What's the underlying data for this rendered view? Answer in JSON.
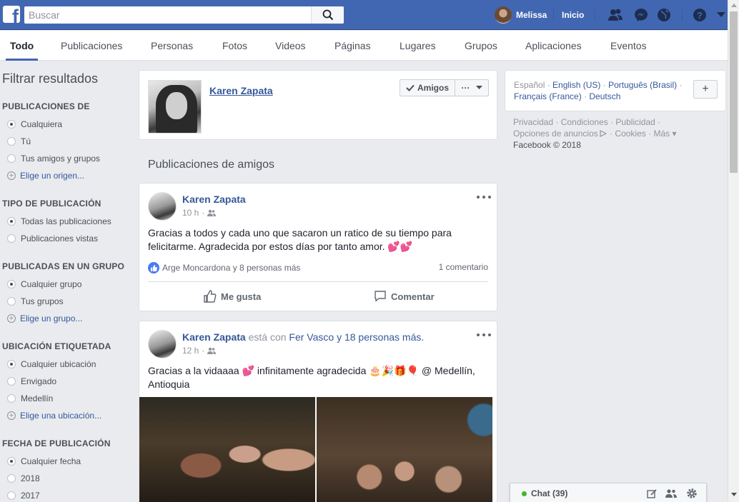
{
  "topbar": {
    "logo_letter": "f",
    "search_placeholder": "Buscar",
    "user_name": "Melissa",
    "home_label": "Inicio",
    "icons": [
      "facebook-logo-icon",
      "search-icon",
      "friend-requests-icon",
      "messenger-icon",
      "globe-notifications-icon",
      "help-icon",
      "caret-down-icon"
    ],
    "brand_color": "#4267b2"
  },
  "tabs": [
    {
      "label": "Todo",
      "active": true
    },
    {
      "label": "Publicaciones"
    },
    {
      "label": "Personas"
    },
    {
      "label": "Fotos"
    },
    {
      "label": "Videos"
    },
    {
      "label": "Páginas"
    },
    {
      "label": "Lugares"
    },
    {
      "label": "Grupos"
    },
    {
      "label": "Aplicaciones"
    },
    {
      "label": "Eventos"
    }
  ],
  "filter": {
    "title": "Filtrar resultados",
    "sections": [
      {
        "title": "PUBLICACIONES DE",
        "options": [
          "Cualquiera",
          "Tú",
          "Tus amigos y grupos"
        ],
        "add": "Elige un origen..."
      },
      {
        "title": "TIPO DE PUBLICACIÓN",
        "options": [
          "Todas las publicaciones",
          "Publicaciones vistas"
        ]
      },
      {
        "title": "PUBLICADAS EN UN GRUPO",
        "options": [
          "Cualquier grupo",
          "Tus grupos"
        ],
        "add": "Elige un grupo..."
      },
      {
        "title": "UBICACIÓN ETIQUETADA",
        "options": [
          "Cualquier ubicación",
          "Envigado",
          "Medellín"
        ],
        "add": "Elige una ubicación..."
      },
      {
        "title": "FECHA DE PUBLICACIÓN",
        "options": [
          "Cualquier fecha",
          "2018",
          "2017"
        ]
      }
    ]
  },
  "profile": {
    "name": "Karen Zapata",
    "friends_button": "Amigos",
    "more_button": "···"
  },
  "section_title": "Publicaciones de amigos",
  "posts": [
    {
      "author": "Karen Zapata",
      "time": "10 h",
      "audience_icon": "friends-audience-icon",
      "text": "Gracias a todos y cada uno que sacaron un ratico de su tiempo para felicitarme. Agradecida por estos días por tanto amor. 💕💕",
      "reactions": "Arge Moncardona y 8 personas más",
      "comments": "1 comentario",
      "like_label": "Me gusta",
      "comment_label": "Comentar"
    },
    {
      "author": "Karen Zapata",
      "with_prefix": "está con",
      "tagged": "Fer Vasco y 18 personas más.",
      "time": "12 h",
      "audience_icon": "friends-audience-icon",
      "text": "Gracias a la vidaaaa 💕 infinitamente agradecida 🎂🎉🎁🎈 @ Medellín, Antioquia"
    }
  ],
  "right": {
    "languages": {
      "current": "Español",
      "links": [
        "English (US)",
        "Português (Brasil)",
        "Français (France)",
        "Deutsch"
      ],
      "add_label": "+"
    },
    "footer": {
      "links": [
        "Privacidad",
        "Condiciones",
        "Publicidad",
        "Opciones de anuncios",
        "Cookies",
        "Más"
      ],
      "copyright": "Facebook © 2018"
    }
  },
  "chat": {
    "label": "Chat (39)",
    "status_color": "#42b72a"
  }
}
